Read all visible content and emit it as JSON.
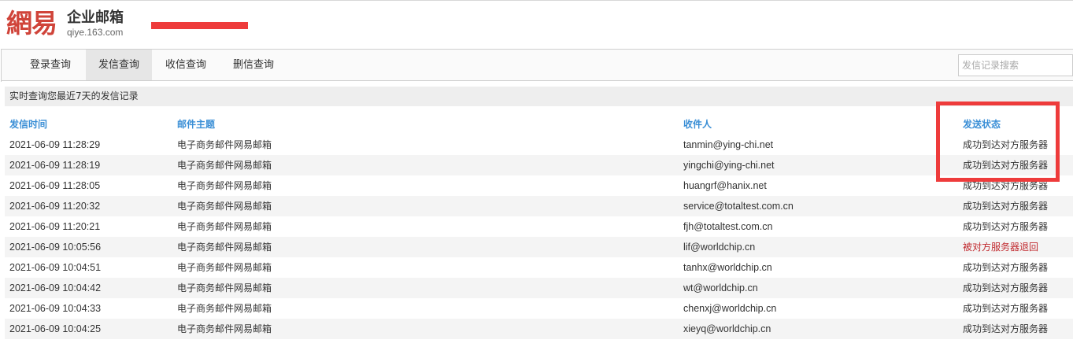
{
  "brand": {
    "logo_text": "網易",
    "product_name": "企业邮箱",
    "domain": "qiye.163.com"
  },
  "tabs": [
    {
      "label": "登录查询"
    },
    {
      "label": "发信查询"
    },
    {
      "label": "收信查询"
    },
    {
      "label": "删信查询"
    }
  ],
  "active_tab": "发信查询",
  "search": {
    "placeholder": "发信记录搜索",
    "value": ""
  },
  "info_text": "实时查询您最近7天的发信记录",
  "table": {
    "headers": {
      "time": "发信时间",
      "subject": "邮件主题",
      "recipient": "收件人",
      "status": "发送状态"
    },
    "rows": [
      {
        "time": "2021-06-09 11:28:29",
        "subject": "电子商务邮件网易邮箱",
        "recipient": "tanmin@ying-chi.net",
        "status": "成功到达对方服务器"
      },
      {
        "time": "2021-06-09 11:28:19",
        "subject": "电子商务邮件网易邮箱",
        "recipient": "yingchi@ying-chi.net",
        "status": "成功到达对方服务器"
      },
      {
        "time": "2021-06-09 11:28:05",
        "subject": "电子商务邮件网易邮箱",
        "recipient": "huangrf@hanix.net",
        "status": "成功到达对方服务器"
      },
      {
        "time": "2021-06-09 11:20:32",
        "subject": "电子商务邮件网易邮箱",
        "recipient": "service@totaltest.com.cn",
        "status": "成功到达对方服务器"
      },
      {
        "time": "2021-06-09 11:20:21",
        "subject": "电子商务邮件网易邮箱",
        "recipient": "fjh@totaltest.com.cn",
        "status": "成功到达对方服务器"
      },
      {
        "time": "2021-06-09 10:05:56",
        "subject": "电子商务邮件网易邮箱",
        "recipient": "lif@worldchip.cn",
        "status": "被对方服务器退回"
      },
      {
        "time": "2021-06-09 10:04:51",
        "subject": "电子商务邮件网易邮箱",
        "recipient": "tanhx@worldchip.cn",
        "status": "成功到达对方服务器"
      },
      {
        "time": "2021-06-09 10:04:42",
        "subject": "电子商务邮件网易邮箱",
        "recipient": "wt@worldchip.cn",
        "status": "成功到达对方服务器"
      },
      {
        "time": "2021-06-09 10:04:33",
        "subject": "电子商务邮件网易邮箱",
        "recipient": "chenxj@worldchip.cn",
        "status": "成功到达对方服务器"
      },
      {
        "time": "2021-06-09 10:04:25",
        "subject": "电子商务邮件网易邮箱",
        "recipient": "xieyq@worldchip.cn",
        "status": "成功到达对方服务器"
      }
    ]
  },
  "colors": {
    "brand_red": "#d0443a",
    "header_blue": "#3b8fd6",
    "bounce_red": "#c0282d",
    "annotation_red": "#ee3b3b"
  }
}
